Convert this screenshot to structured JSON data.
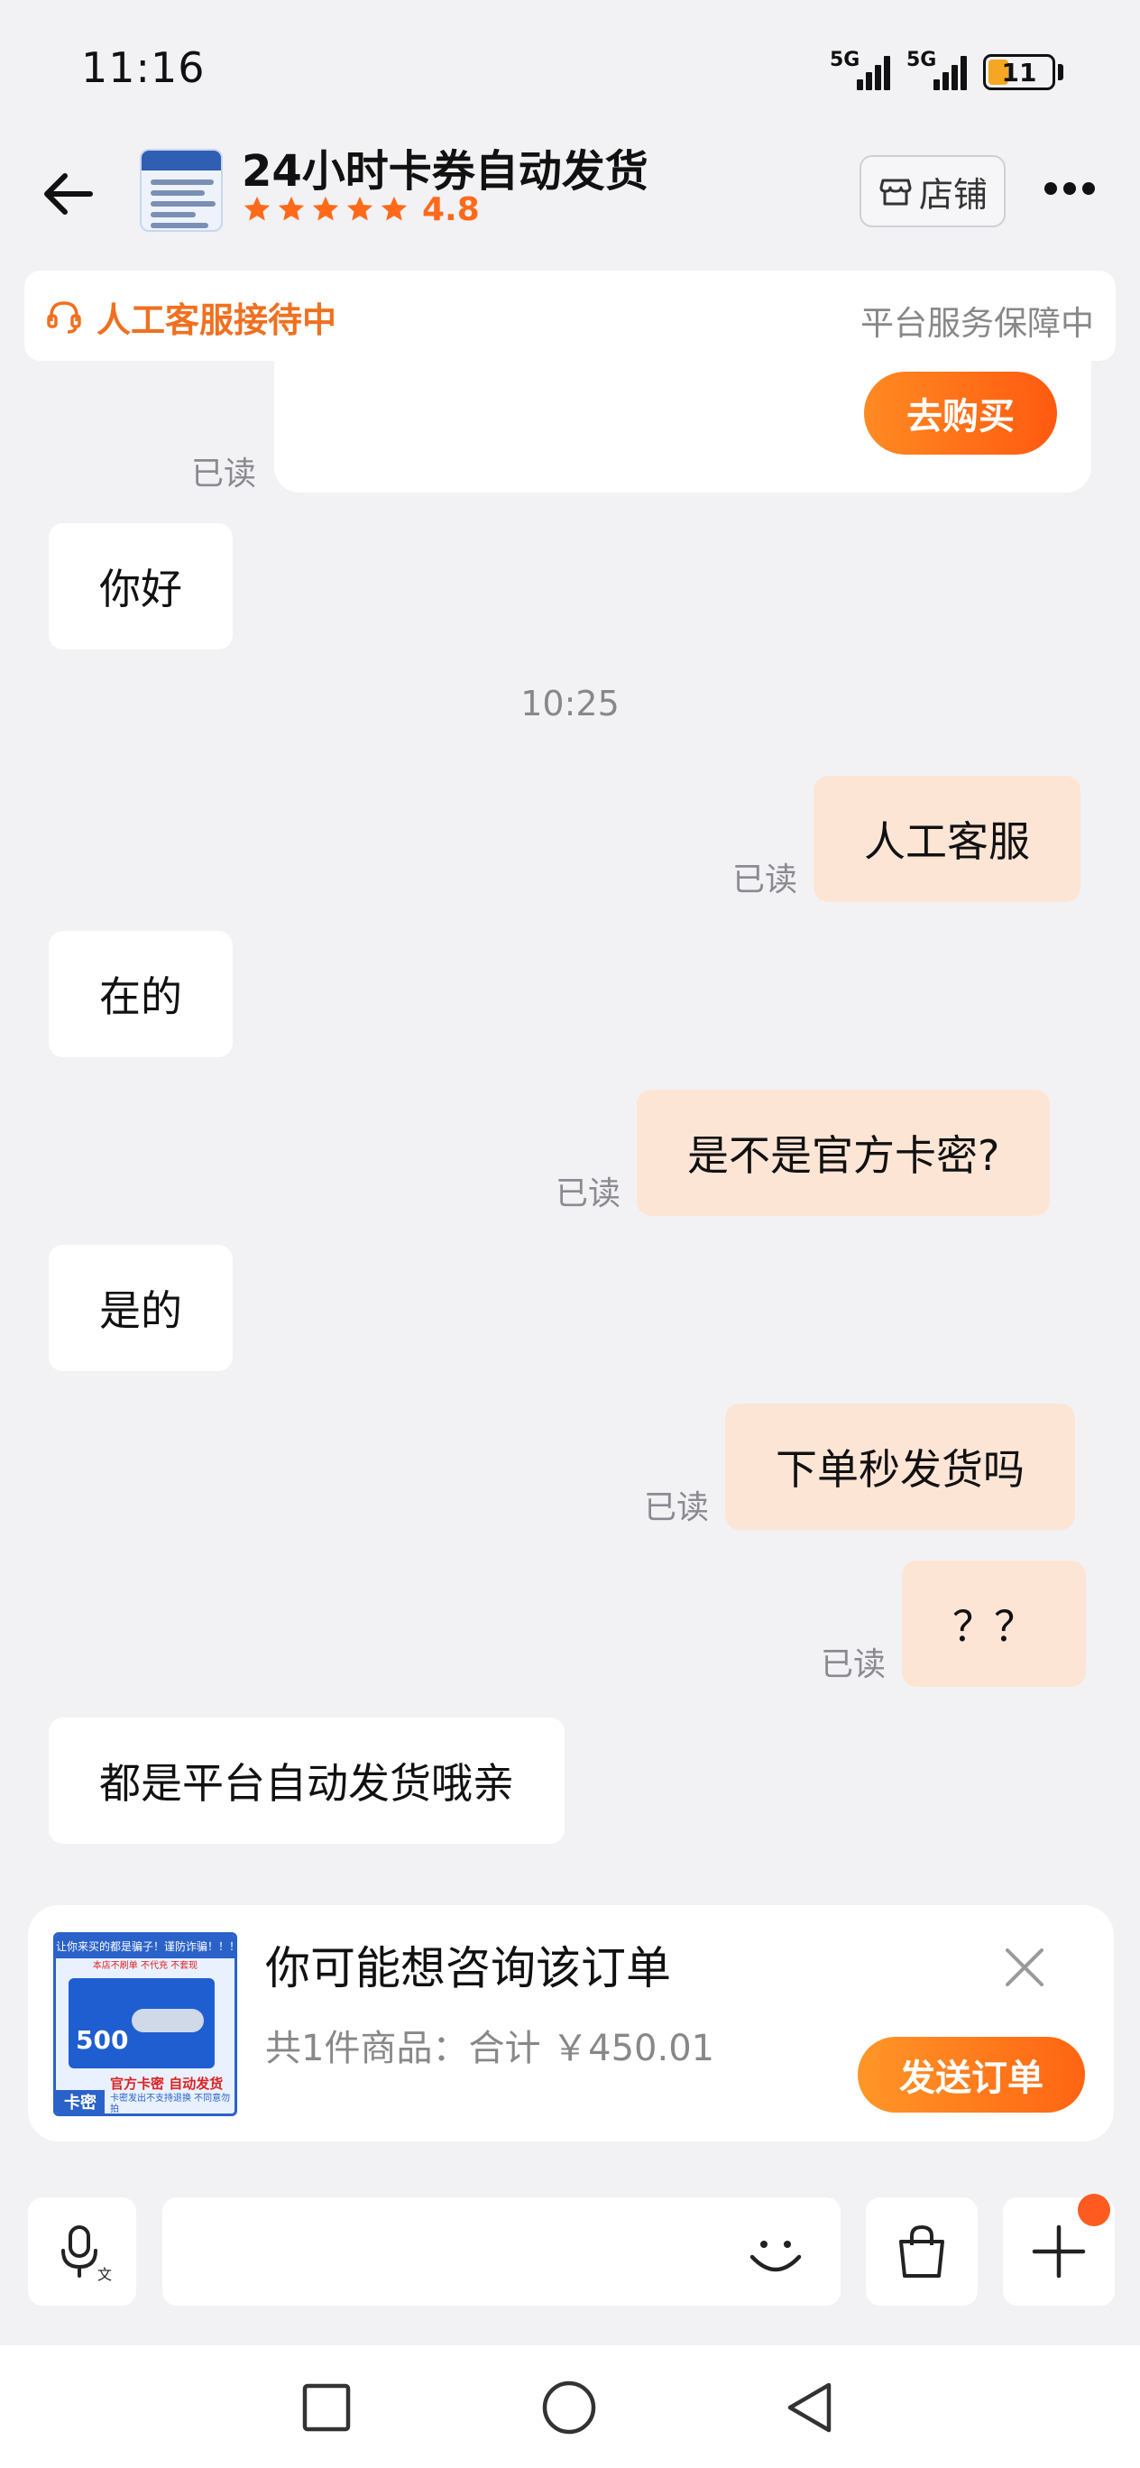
{
  "status_bar": {
    "time": "11:16",
    "signal_1": "5G",
    "signal_2": "5G",
    "battery": "11"
  },
  "header": {
    "title": "24小时卡券自动发货",
    "rating": "4.8",
    "store_label": "店铺"
  },
  "service": {
    "status": "人工客服接待中",
    "guarantee": "平台服务保障中"
  },
  "chat": {
    "buy_label": "去购买",
    "read_label": "已读",
    "time_separator": "10:25",
    "messages": [
      {
        "side": "in",
        "text": "你好"
      },
      {
        "side": "out",
        "text": "人工客服",
        "read": "已读"
      },
      {
        "side": "in",
        "text": "在的"
      },
      {
        "side": "out",
        "text": "是不是官方卡密?",
        "read": "已读"
      },
      {
        "side": "in",
        "text": "是的"
      },
      {
        "side": "out",
        "text": "下单秒发货吗",
        "read": "已读"
      },
      {
        "side": "out",
        "text": "？？",
        "read": "已读"
      },
      {
        "side": "in",
        "text": "都是平台自动发货哦亲"
      }
    ]
  },
  "order_suggestion": {
    "title": "你可能想咨询该订单",
    "summary": "共1件商品：合计 ￥450.01",
    "send_label": "发送订单",
    "thumb": {
      "banner": "让你来买的都是骗子！谨防诈骗！！！",
      "sub": "本店不刷单 不代充 不套现",
      "value": "500",
      "tagline": "官方卡密 自动发货",
      "kami": "卡密",
      "note": "卡密发出不支持退换 不同意勿拍"
    },
    "colors": {
      "accent": "#ff6a1a",
      "bubble_out": "#fde5d6"
    }
  },
  "input": {
    "placeholder": ""
  }
}
